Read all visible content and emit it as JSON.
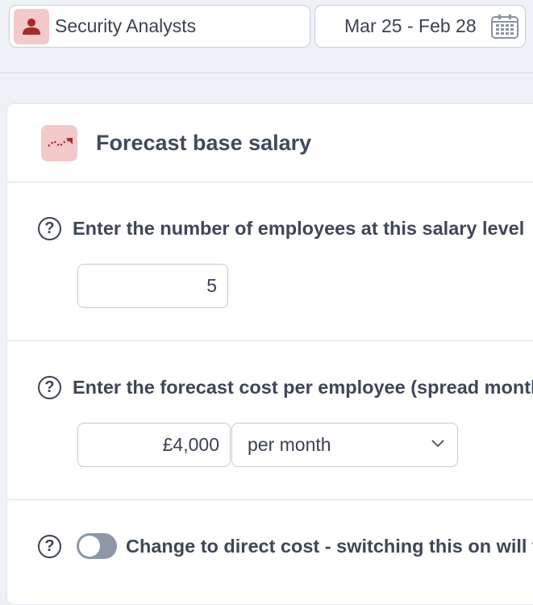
{
  "header": {
    "role_label": "Security Analysts",
    "date_range": "Mar 25 - Feb 28"
  },
  "card": {
    "title": "Forecast base salary",
    "employees_question": "Enter the number of employees at this salary level",
    "employees_value": "5",
    "cost_question": "Enter the forecast cost per employee (spread month",
    "cost_value": "£4,000",
    "period_selected": "per month",
    "direct_cost_label": "Change to direct cost - switching this on will t",
    "direct_cost_enabled": false
  },
  "icons": {
    "help": "?"
  },
  "colors": {
    "accent": "#a52a2a",
    "accent_bg": "#f3c9c9",
    "toggle_off": "#8d97a5"
  }
}
